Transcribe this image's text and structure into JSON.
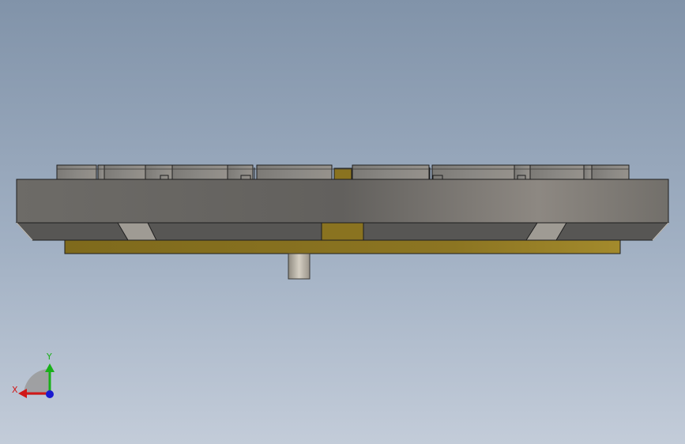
{
  "viewport": {
    "background_top": "#8193a9",
    "background_bottom": "#c3ccd9"
  },
  "model": {
    "colors": {
      "body_gray": "#6f6d69",
      "body_gray_light": "#8e8a84",
      "chamfer": "#575654",
      "keycap": "#8a8884",
      "plate_gold": "#8a7320",
      "plate_gold_light": "#a28a2a",
      "shaft": "#bdb6a9",
      "edge": "#1e1e1e"
    }
  },
  "triad": {
    "x_label": "X",
    "y_label": "Y",
    "x_color": "#d01818",
    "y_color": "#19b019",
    "z_color": "#1a1ad0"
  }
}
